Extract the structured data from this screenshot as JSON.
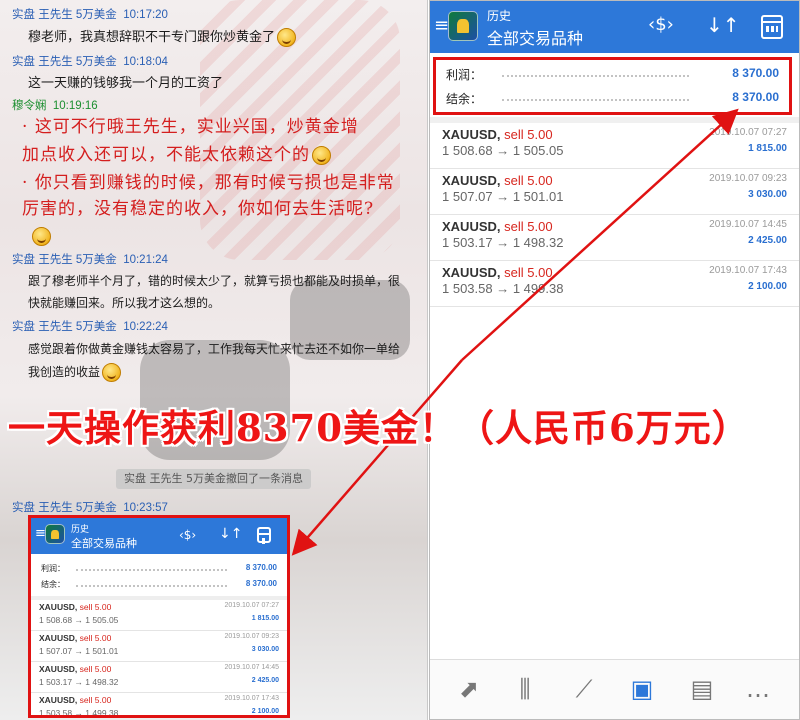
{
  "chat": {
    "messages": [
      {
        "header": "实盘 王先生 5万美金",
        "time": "10:17:20",
        "lines": [
          "穆老师，我真想辞职不干专门跟你炒黄金了"
        ]
      },
      {
        "header": "实盘 王先生 5万美金",
        "time": "10:18:04",
        "lines": [
          "这一天赚的钱够我一个月的工资了"
        ]
      },
      {
        "header": "穆令娴",
        "time": "10:19:16",
        "lines": [
          "这可不行哦王先生，实业兴国，炒黄金增",
          "加点收入还可以，不能太依赖这个的",
          "你只看到赚钱的时候，那有时候亏损也是非常",
          "厉害的，没有稳定的收入，你如何去生活呢?"
        ]
      },
      {
        "header": "实盘 王先生 5万美金",
        "time": "10:21:24",
        "lines": [
          "跟了穆老师半个月了，错的时候太少了，就算亏损也都能及时损单，很",
          "快就能赚回来。所以我才这么想的。"
        ]
      },
      {
        "header": "实盘 王先生 5万美金",
        "time": "10:22:24",
        "lines": [
          "感觉跟着你做黄金赚钱太容易了，工作我每天忙来忙去还不如你一单给",
          "我创造的收益"
        ]
      },
      {
        "header": "实盘 王先生 5万美金",
        "time": "10:23:57",
        "lines": []
      }
    ],
    "recall_notice": "实盘 王先生 5万美金撤回了一条消息"
  },
  "headline": "一天操作获利8370美金！（人民币6万元）",
  "app": {
    "title_small": "历史",
    "title_main": "全部交易品种",
    "menu_icon": "≡",
    "currency_icon": "‹$›",
    "sort_icon": "↓↑",
    "summary": [
      {
        "label": "利润：",
        "value": "8 370.00"
      },
      {
        "label": "结余：",
        "value": "8 370.00"
      }
    ],
    "deals": [
      {
        "symbol": "XAUUSD,",
        "side": "sell 5.00",
        "prices": "1 508.68 → 1 505.05",
        "time": "2019.10.07 07:27",
        "profit": "1 815.00"
      },
      {
        "symbol": "XAUUSD,",
        "side": "sell 5.00",
        "prices": "1 507.07 → 1 501.01",
        "time": "2019.10.07 09:23",
        "profit": "3 030.00"
      },
      {
        "symbol": "XAUUSD,",
        "side": "sell 5.00",
        "prices": "1 503.17 → 1 498.32",
        "time": "2019.10.07 14:45",
        "profit": "2 425.00"
      },
      {
        "symbol": "XAUUSD,",
        "side": "sell 5.00",
        "prices": "1 503.58 → 1 499.38",
        "time": "2019.10.07 17:43",
        "profit": "2 100.00"
      }
    ],
    "bottom_nav": [
      "⬈",
      "⫼",
      "⟋",
      "▣",
      "▤",
      "…"
    ]
  },
  "colors": {
    "accent": "#2d78d9",
    "highlight_red": "#e01212",
    "profit_blue": "#2a6fd0"
  }
}
